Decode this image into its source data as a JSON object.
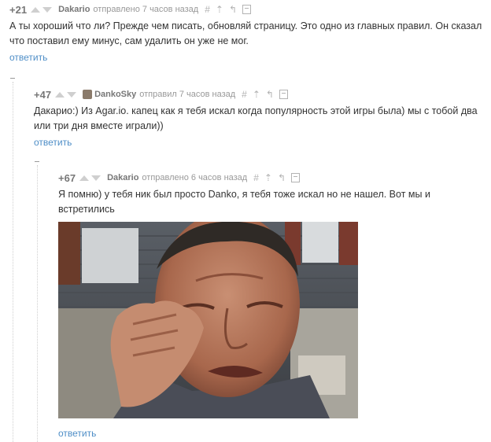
{
  "comments": [
    {
      "rating": "+21",
      "author": "Dakario",
      "meta": "отправлено 7 часов назад",
      "text": "А ты хороший что ли? Прежде чем писать, обновляй страницу. Это одно из главных правил. Он сказал что поставил ему минус, сам удалить он уже не мог.",
      "reply": "ответить"
    },
    {
      "rating": "+47",
      "author": "DankoSky",
      "meta": "отправил 7 часов назад",
      "text": "Дакарио:) Из  Agar.io.  капец как я тебя искал когда популярность этой игры была) мы с тобой два или три дня вместе играли))",
      "reply": "ответить"
    },
    {
      "rating": "+67",
      "author": "Dakario",
      "meta": "отправлено 6 часов назад",
      "text": "Я помню) у тебя ник был просто Danko, я тебя тоже искал но не нашел. Вот мы и встретились",
      "reply": "ответить"
    }
  ],
  "tools": {
    "hash": "#",
    "up": "⇡",
    "parent": "↰"
  },
  "icons": [
    "arrow-up-icon",
    "arrow-down-icon",
    "avatar-icon",
    "save-icon",
    "collapse-icon"
  ],
  "colors": {
    "link": "#4e8ec7",
    "meta": "#999999",
    "text": "#333333"
  }
}
